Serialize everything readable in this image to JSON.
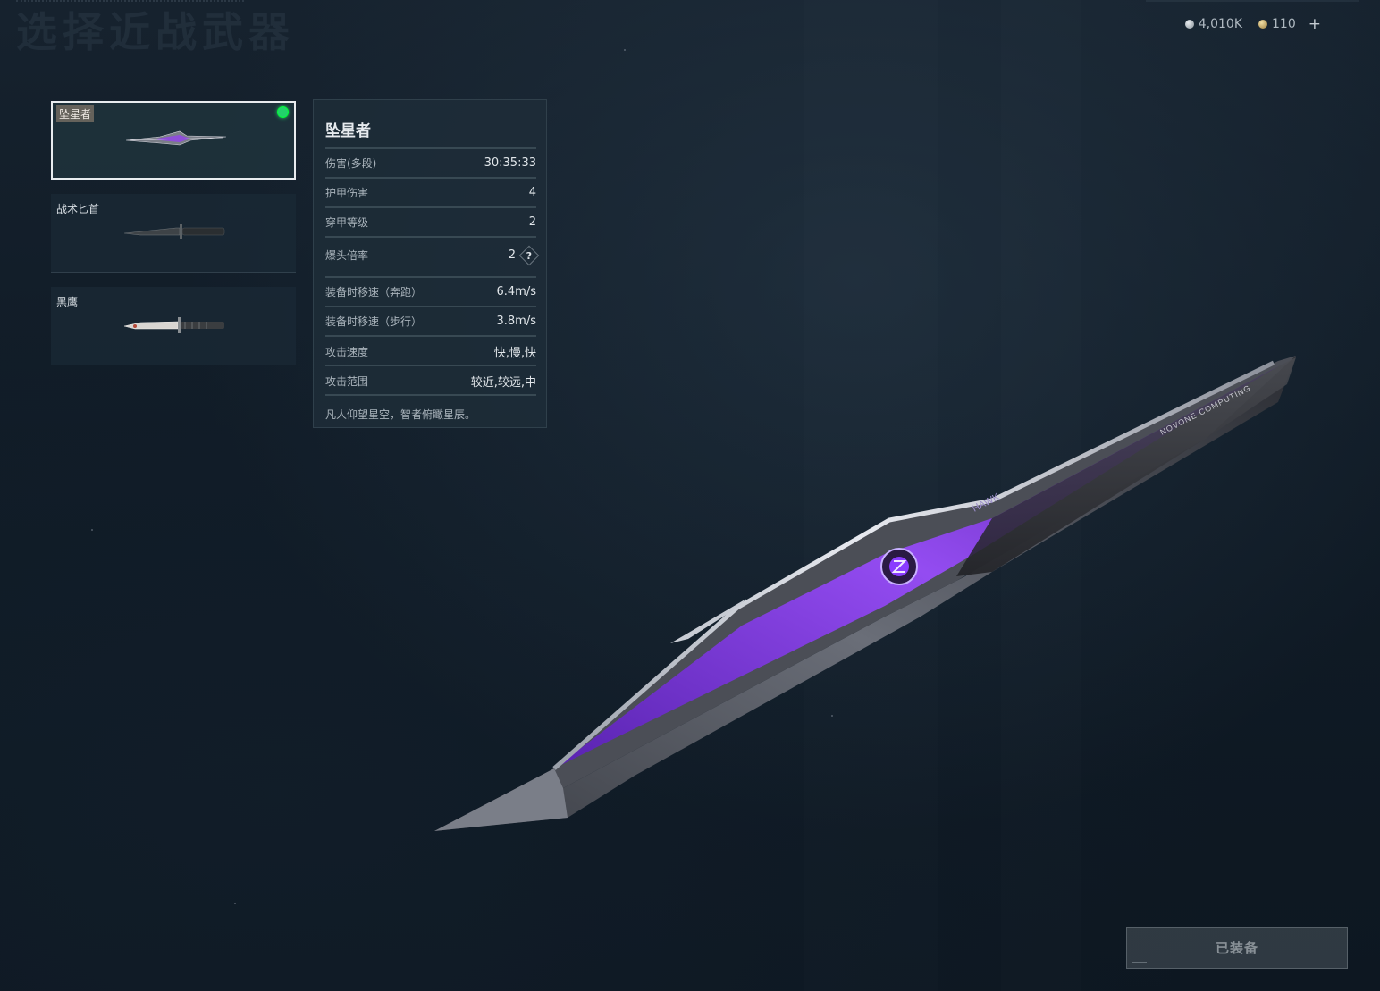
{
  "page": {
    "title": "选择近战武器"
  },
  "currency": {
    "silver": "4,010K",
    "gold": "110",
    "plus": "+"
  },
  "weapons": [
    {
      "name": "坠星者",
      "selected": true,
      "equipped": true
    },
    {
      "name": "战术匕首",
      "selected": false,
      "equipped": false
    },
    {
      "name": "黑鹰",
      "selected": false,
      "equipped": false
    }
  ],
  "stats": {
    "title": "坠星者",
    "rows": [
      {
        "label": "伤害(多段)",
        "value": "30:35:33"
      },
      {
        "label": "护甲伤害",
        "value": "4"
      },
      {
        "label": "穿甲等级",
        "value": "2"
      },
      {
        "label": "爆头倍率",
        "value": "2"
      },
      {
        "label": "装备时移速（奔跑）",
        "value": "6.4m/s"
      },
      {
        "label": "装备时移速（步行）",
        "value": "3.8m/s"
      },
      {
        "label": "攻击速度",
        "value": "快,慢,快"
      },
      {
        "label": "攻击范围",
        "value": "较近,较远,中"
      }
    ],
    "help_symbol": "?",
    "description": "凡人仰望星空，智者俯瞰星辰。"
  },
  "blade_text": {
    "brand": "HAWK",
    "maker": "NOVONE COMPUTING"
  },
  "equip_button": {
    "label": "已装备"
  },
  "colors": {
    "accent_purple": "#8a3cff",
    "equipped_green": "#22d26b",
    "panel_bg": "#1e2c38"
  }
}
